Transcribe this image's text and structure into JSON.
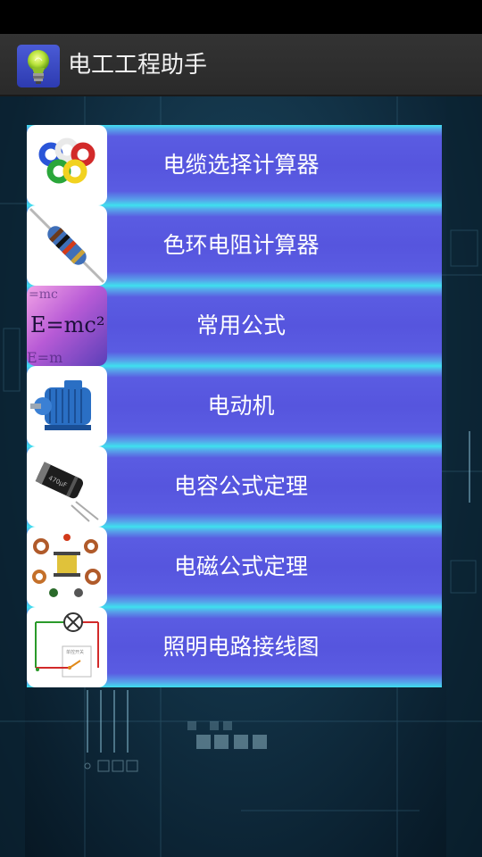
{
  "app": {
    "title": "电工工程助手",
    "icon": "lightbulb-icon"
  },
  "menu": {
    "items": [
      {
        "label": "电缆选择计算器",
        "icon": "cable-rings-icon"
      },
      {
        "label": "色环电阻计算器",
        "icon": "resistor-icon"
      },
      {
        "label": "常用公式",
        "icon": "formula-emc2-icon",
        "thumb_text": "E=mc²"
      },
      {
        "label": "电动机",
        "icon": "electric-motor-icon"
      },
      {
        "label": "电容公式定理",
        "icon": "capacitor-icon"
      },
      {
        "label": "电磁公式定理",
        "icon": "electromagnetic-components-icon"
      },
      {
        "label": "照明电路接线图",
        "icon": "lighting-circuit-icon",
        "thumb_text": "单控开关"
      }
    ]
  },
  "colors": {
    "accent_band": "#5655de",
    "band_edge": "#3fe0ee",
    "action_bar": "#2f2f2f"
  }
}
